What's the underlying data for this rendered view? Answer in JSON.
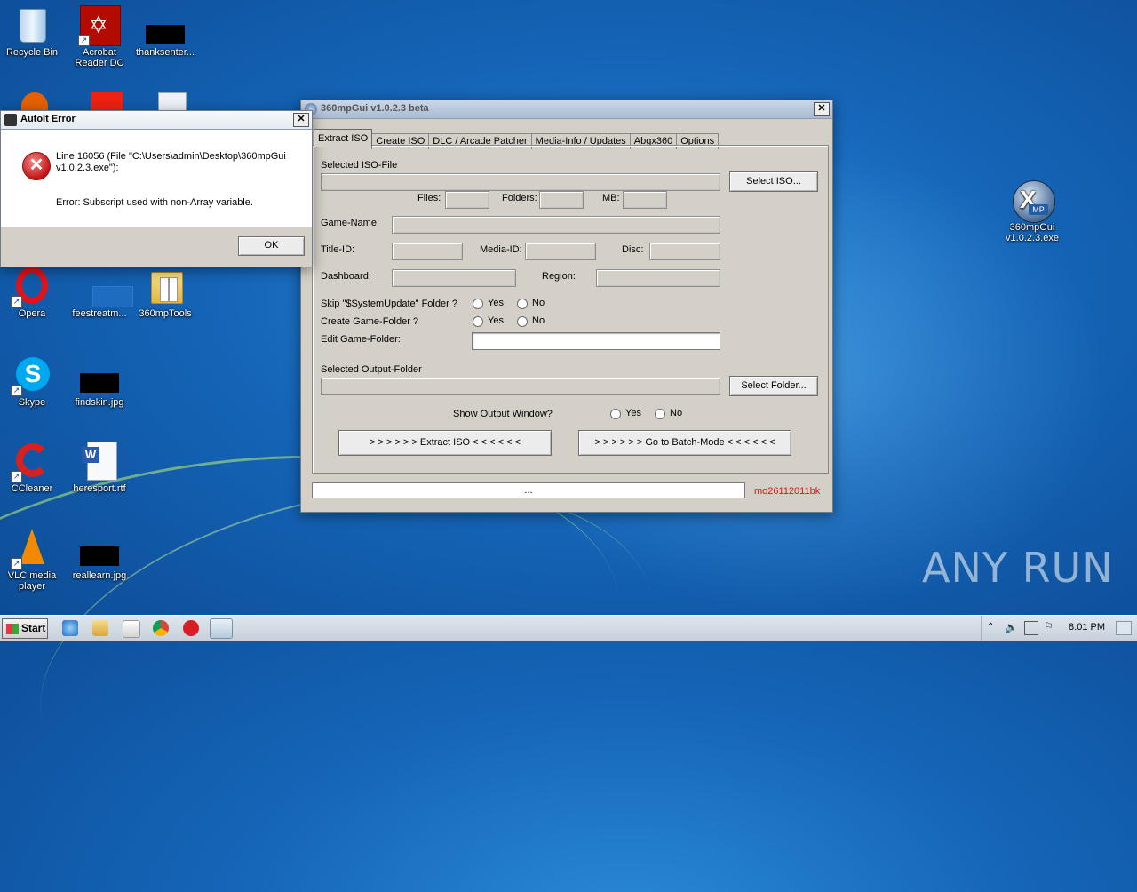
{
  "desktop": {
    "icons": [
      {
        "label": "Recycle Bin"
      },
      {
        "label": "Acrobat Reader DC"
      },
      {
        "label": "thanksenter..."
      },
      {
        "label": "Opera"
      },
      {
        "label": "feestreatm..."
      },
      {
        "label": "360mpTools"
      },
      {
        "label": "Skype"
      },
      {
        "label": "findskin.jpg"
      },
      {
        "label": "CCleaner"
      },
      {
        "label": "heresport.rtf"
      },
      {
        "label": "VLC media player"
      },
      {
        "label": "reallearn.jpg"
      },
      {
        "label": "360mpGui v1.0.2.3.exe"
      }
    ],
    "watermark": "ANY RUN"
  },
  "app": {
    "title": "360mpGui v1.0.2.3 beta",
    "tabs": [
      "Extract ISO",
      "Create ISO",
      "DLC / Arcade Patcher",
      "Media-Info / Updates",
      "Abgx360",
      "Options"
    ],
    "labels": {
      "selected_iso": "Selected ISO-File",
      "files": "Files:",
      "folders": "Folders:",
      "mb": "MB:",
      "game_name": "Game-Name:",
      "title_id": "Title-ID:",
      "media_id": "Media-ID:",
      "disc": "Disc:",
      "dashboard": "Dashboard:",
      "region": "Region:",
      "skip_update": "Skip \"$SystemUpdate\" Folder ?",
      "create_folder": "Create Game-Folder ?",
      "edit_folder": "Edit Game-Folder:",
      "output_folder": "Selected Output-Folder",
      "show_output": "Show Output Window?",
      "yes": "Yes",
      "no": "No"
    },
    "buttons": {
      "select_iso": "Select ISO...",
      "select_folder": "Select Folder...",
      "extract": "> > > > > >  Extract ISO  < < < < < <",
      "batch": "> > > > > >  Go to Batch-Mode  < < < < < <"
    },
    "status_text": "...",
    "credit": "mo26112011bk"
  },
  "error": {
    "title": "AutoIt Error",
    "line1": "Line 16056  (File \"C:\\Users\\admin\\Desktop\\360mpGui",
    "line2": "v1.0.2.3.exe\"):",
    "message": "Error: Subscript used with non-Array variable.",
    "ok": "OK"
  },
  "taskbar": {
    "start": "Start",
    "clock": "8:01 PM"
  }
}
